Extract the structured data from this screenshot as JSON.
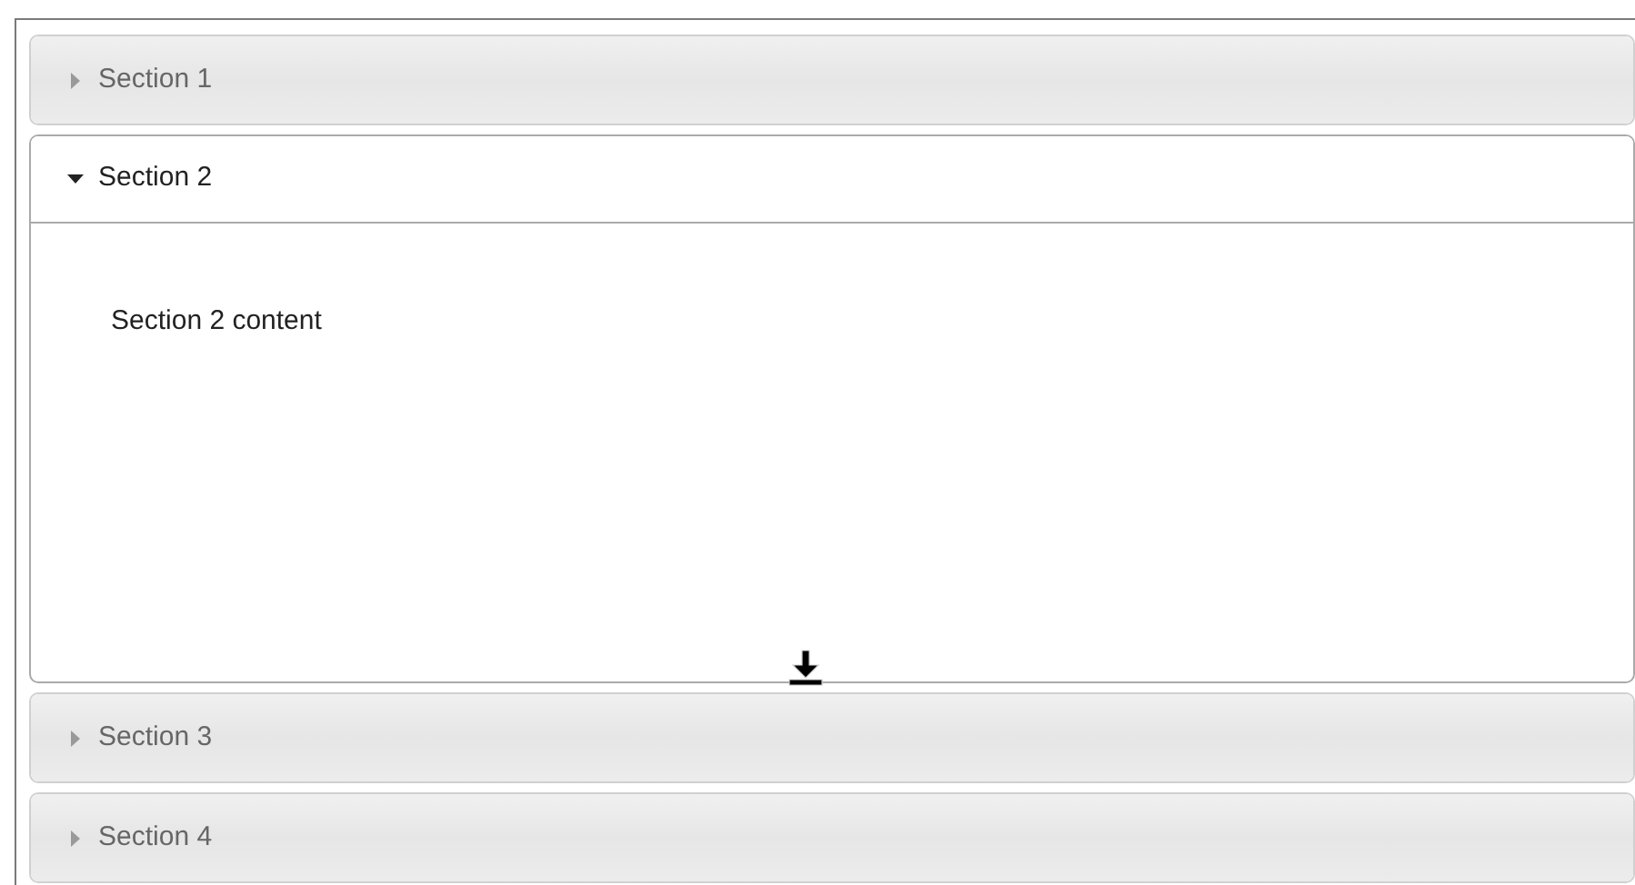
{
  "sections": [
    {
      "title": "Section 1",
      "expanded": false
    },
    {
      "title": "Section 2",
      "expanded": true,
      "content": "Section 2 content"
    },
    {
      "title": "Section 3",
      "expanded": false
    },
    {
      "title": "Section 4",
      "expanded": false
    }
  ]
}
